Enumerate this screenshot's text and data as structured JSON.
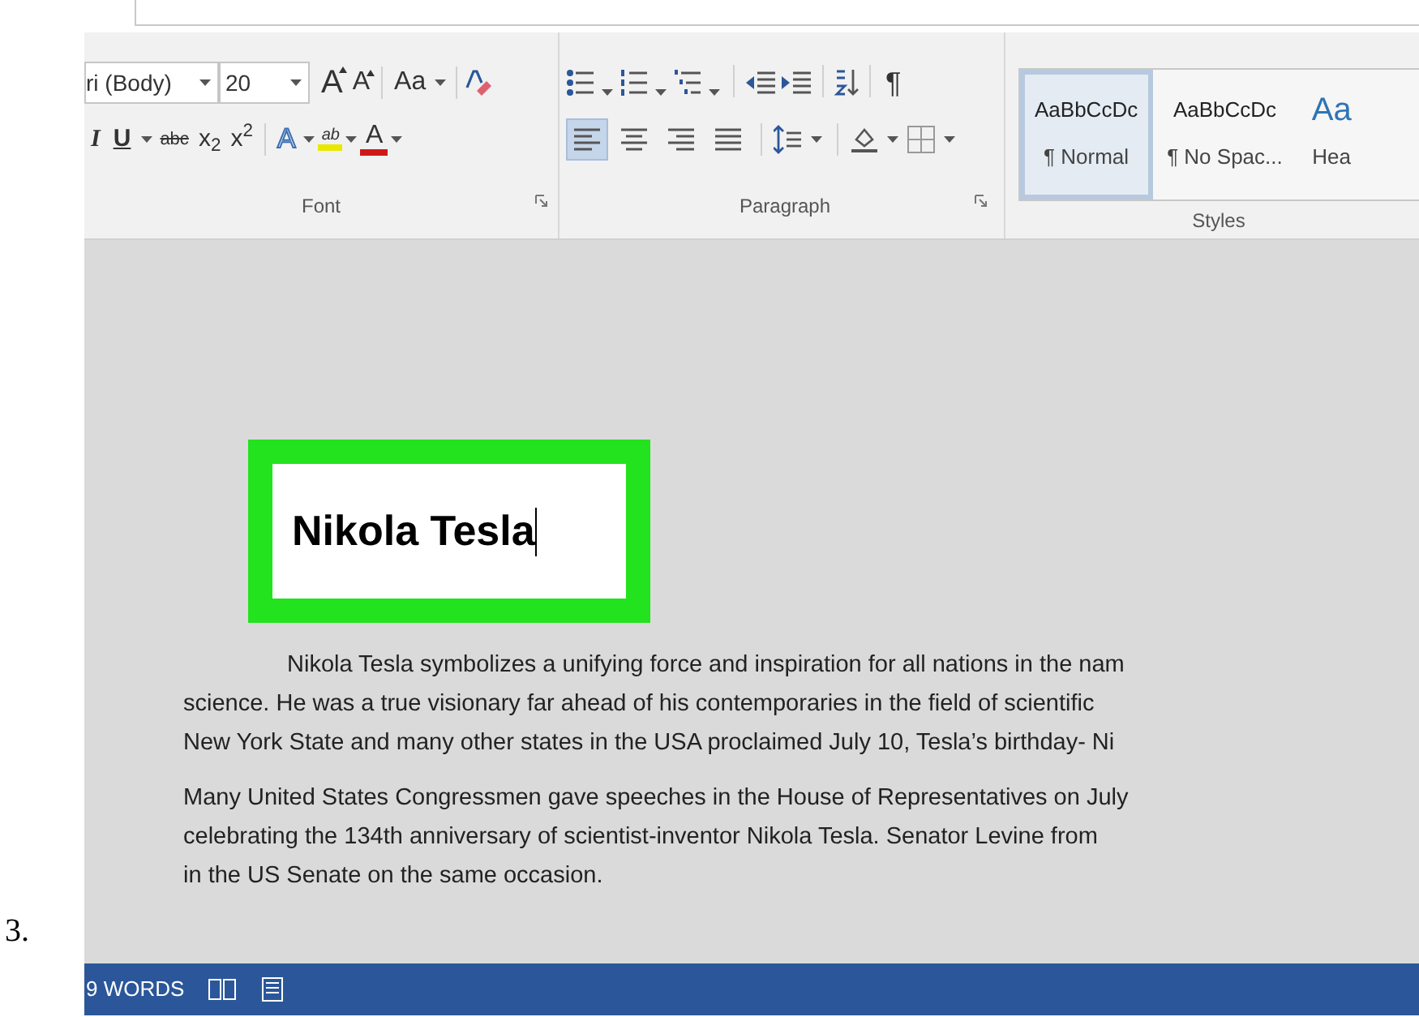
{
  "step_number": "3.",
  "font": {
    "font_name": "ri (Body)",
    "font_size": "20",
    "row1": [
      {
        "kind": "grow",
        "label": "A"
      },
      {
        "kind": "shrink",
        "label": "A"
      },
      {
        "kind": "case",
        "label": "Aa"
      },
      {
        "kind": "clear"
      }
    ],
    "row2": [
      {
        "kind": "italic",
        "label": "I"
      },
      {
        "kind": "underline",
        "label": "U"
      },
      {
        "kind": "strike",
        "label": "abc"
      },
      {
        "kind": "script",
        "label": "x$_{2}$"
      },
      {
        "kind": "script",
        "label": "x$^{2}$"
      },
      {
        "kind": "effects",
        "label": "A"
      },
      {
        "kind": "highlight",
        "label": "ab"
      },
      {
        "kind": "color",
        "label": "A"
      }
    ],
    "label": "Font"
  },
  "paragraph": {
    "marks_label": "¶",
    "alignments": [
      {
        "selected": true
      },
      {
        "selected": false
      },
      {
        "selected": false
      },
      {
        "selected": false
      }
    ],
    "label": "Paragraph"
  },
  "styles": {
    "items": [
      {
        "kind": "body",
        "sample": "AaBbCcDc",
        "name": "¶ Normal",
        "selected": true
      },
      {
        "kind": "body",
        "sample": "AaBbCcDc",
        "name": "¶ No Spac...",
        "selected": false
      },
      {
        "kind": "heading",
        "sample": "Aa",
        "name": "Hea",
        "selected": false
      }
    ],
    "label": "Styles"
  },
  "document": {
    "title": "Nikola Tesla",
    "paragraphs": [
      [
        "Nikola Tesla symbolizes a unifying force and inspiration for all nations in the nam",
        "science. He was a true visionary far ahead of his contemporaries in the field of scientific",
        "New York State and many other states in the USA proclaimed July 10, Tesla’s birthday- Ni"
      ],
      [
        "Many United States Congressmen gave speeches in the House of Representatives on July",
        "celebrating the 134th anniversary of scientist-inventor Nikola Tesla. Senator Levine from",
        "in the US Senate on the same occasion."
      ]
    ]
  },
  "status_bar": {
    "word_count": "9 WORDS"
  }
}
